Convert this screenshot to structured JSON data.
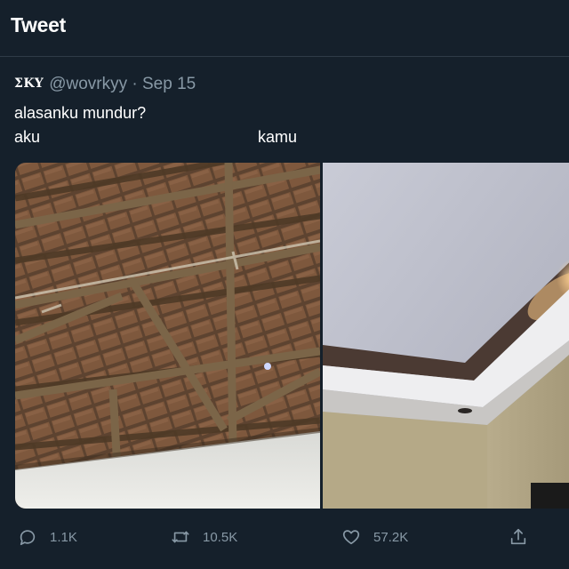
{
  "header": {
    "title": "Tweet"
  },
  "tweet": {
    "display_name": "ΣKY",
    "handle": "@wovrkyy",
    "separator": "·",
    "date": "Sep 15",
    "text_line1": "alasanku mundur?",
    "label_left": "aku",
    "label_right": "kamu"
  },
  "media": {
    "left": {
      "description_icon": "roof-truss-photo"
    },
    "right": {
      "description_icon": "plaster-ceiling-photo"
    }
  },
  "actions": {
    "reply_count": "1.1K",
    "retweet_count": "10.5K",
    "like_count": "57.2K"
  },
  "colors": {
    "background": "#15202b",
    "muted_text": "#8899a6",
    "divider": "#2f3b47"
  }
}
